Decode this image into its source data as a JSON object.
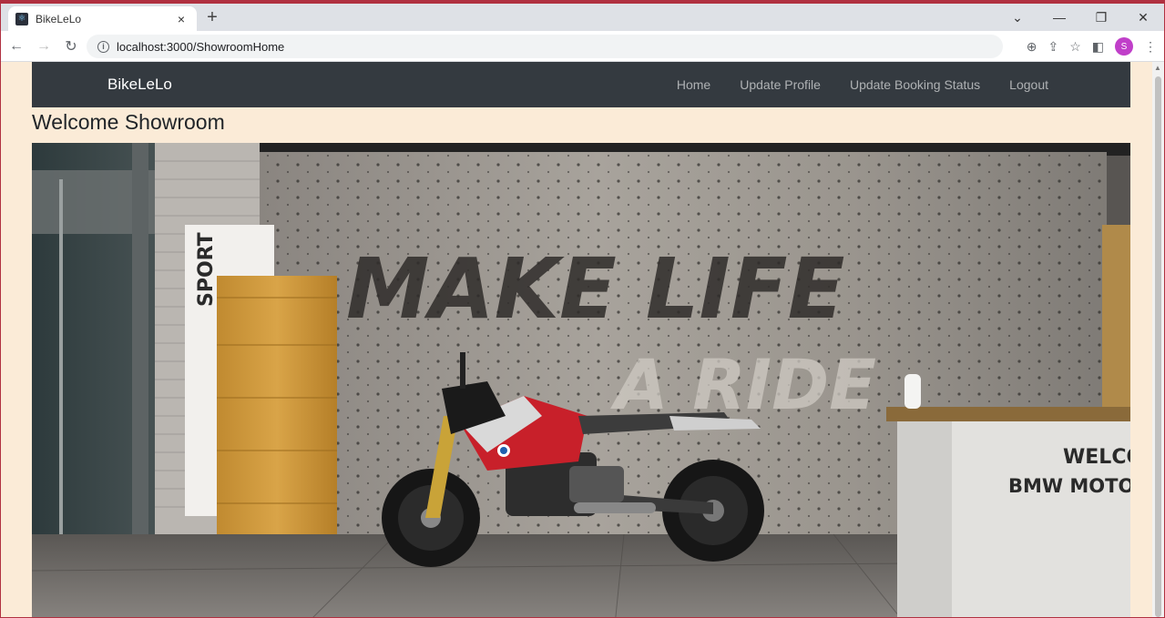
{
  "browser": {
    "tab_title": "BikeLeLo",
    "url": "localhost:3000/ShowroomHome",
    "profile_initial": "S",
    "tab_close_glyph": "×",
    "new_tab_glyph": "+"
  },
  "navbar": {
    "brand": "BikeLeLo",
    "links": [
      "Home",
      "Update Profile",
      "Update Booking Status",
      "Logout"
    ]
  },
  "page": {
    "heading": "Welcome Showroom"
  },
  "hero": {
    "wall_text_line1": "MAKE LIFE",
    "wall_text_line2": "A RIDE",
    "sign_text": "SPORT",
    "desk_text_line1": "WELCO",
    "desk_text_line2": "BMW MOTORR"
  },
  "colors": {
    "navbar_bg": "#343a40",
    "page_bg": "#fbebd7",
    "accent_red": "#c8202a"
  }
}
